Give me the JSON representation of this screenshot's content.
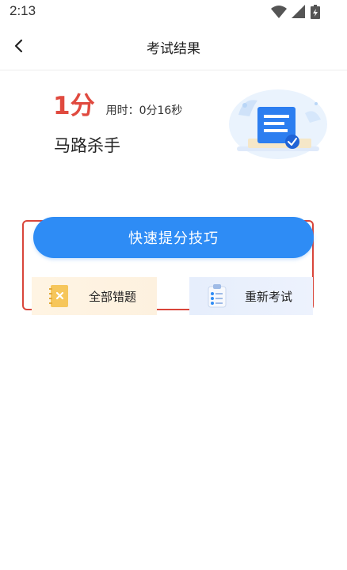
{
  "status_bar": {
    "time": "2:13",
    "icons": [
      "wifi-icon",
      "signal-icon",
      "battery-icon"
    ]
  },
  "nav": {
    "back_icon": "chevron-left-icon",
    "title": "考试结果"
  },
  "result": {
    "score": "1分",
    "time_label": "用时：",
    "time_value": "0分16秒",
    "rank_title": "马路杀手",
    "illustration_icon": "exam-document-check-icon"
  },
  "actions": {
    "primary_label": "快速提分技巧",
    "wrong_questions_label": "全部错题",
    "retake_label": "重新考试"
  },
  "colors": {
    "score": "#e04a3f",
    "primary_button": "#2e8cf5",
    "highlight_border": "#d9453a",
    "wrong_card_bg": "#fff4e3",
    "retry_card_bg": "#e6eefc"
  }
}
